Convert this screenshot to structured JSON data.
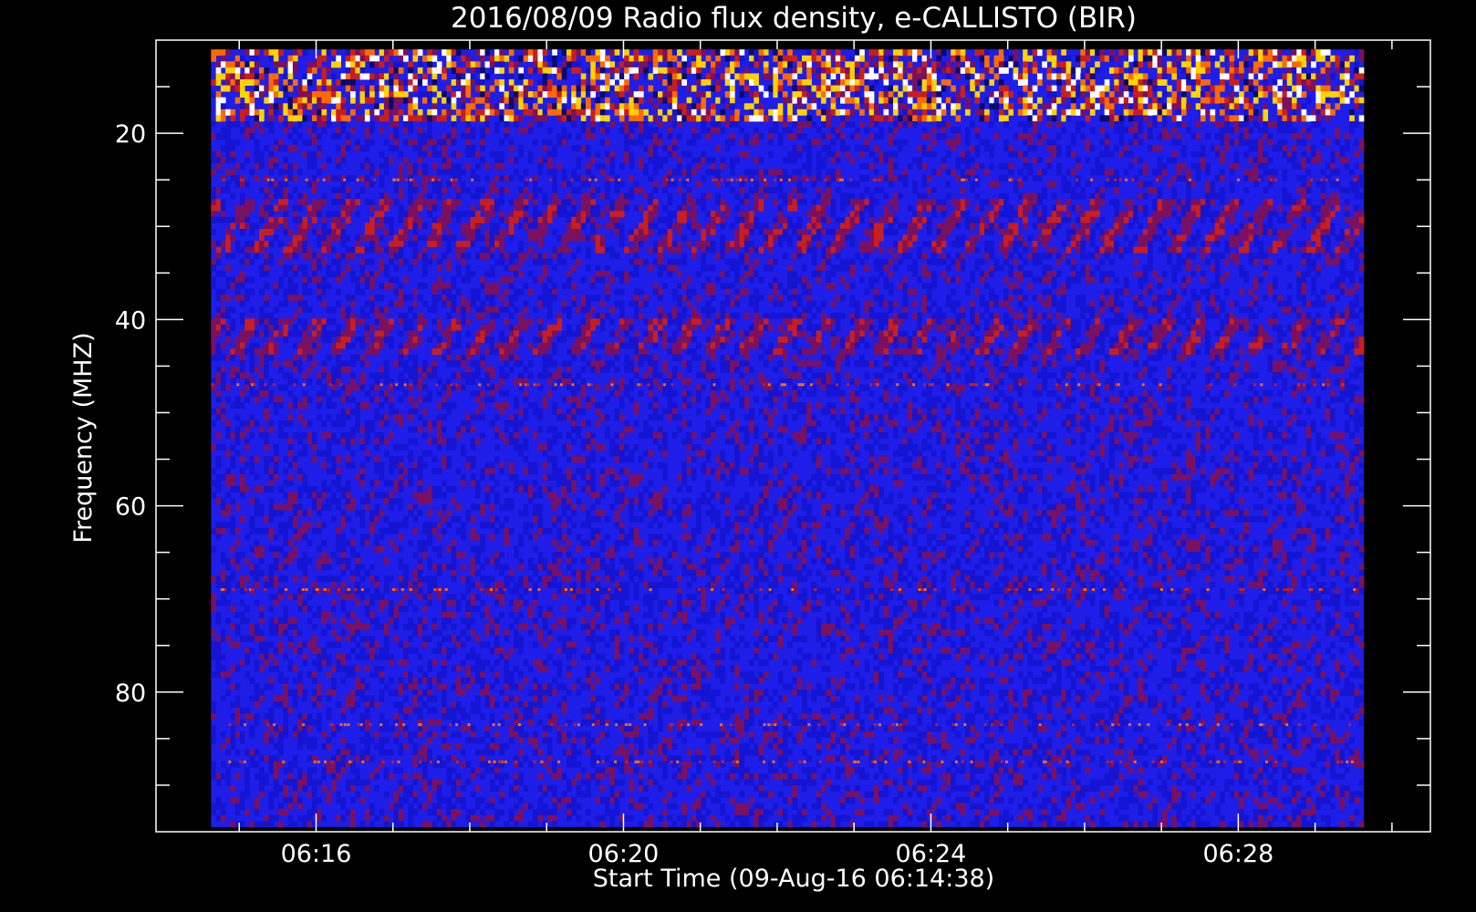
{
  "chart_data": {
    "type": "heatmap",
    "title": "2016/08/09  Radio flux density, e-CALLISTO (BIR)",
    "xlabel": "Start Time (09-Aug-16 06:14:38)",
    "ylabel": "Frequency (MHZ)",
    "x_unit": "time (HH:MM, UT)",
    "xlim": [
      "06:13:55",
      "06:30:30"
    ],
    "ylim": [
      95,
      10
    ],
    "data_range": {
      "time": [
        "06:14:38",
        "06:29:38"
      ],
      "frequency_mhz": [
        11,
        94.5
      ]
    },
    "x_ticks": [
      {
        "time": "06:16",
        "label": "06:16"
      },
      {
        "time": "06:20",
        "label": "06:20"
      },
      {
        "time": "06:24",
        "label": "06:24"
      },
      {
        "time": "06:28",
        "label": "06:28"
      }
    ],
    "x_minor_ticks": [
      "06:15",
      "06:17",
      "06:18",
      "06:19",
      "06:21",
      "06:22",
      "06:23",
      "06:25",
      "06:26",
      "06:27",
      "06:29",
      "06:30"
    ],
    "y_ticks": [
      {
        "value": 20,
        "label": "20"
      },
      {
        "value": 40,
        "label": "40"
      },
      {
        "value": 60,
        "label": "60"
      },
      {
        "value": 80,
        "label": "80"
      }
    ],
    "y_minor_ticks": [
      15,
      25,
      30,
      35,
      45,
      50,
      55,
      65,
      70,
      75,
      85,
      90
    ],
    "colormap": [
      "#000000",
      "#0a0a6e",
      "#1414d2",
      "#2020ff",
      "#7a1060",
      "#c81e1e",
      "#ff6a00",
      "#ffd200",
      "#ffffff"
    ],
    "features": [
      {
        "name": "broadband interference (10–18 MHz)",
        "freq_range_mhz": [
          11,
          18.5
        ],
        "level": "high"
      },
      {
        "name": "narrowband line",
        "freq_mhz": 25,
        "level": "medium"
      },
      {
        "name": "drifting striations",
        "freq_range_mhz": [
          27,
          33
        ],
        "level": "medium"
      },
      {
        "name": "drifting striations",
        "freq_range_mhz": [
          40,
          44
        ],
        "level": "medium"
      },
      {
        "name": "narrowband line",
        "freq_mhz": 47,
        "level": "medium"
      },
      {
        "name": "narrowband line",
        "freq_mhz": 69,
        "level": "medium"
      },
      {
        "name": "narrowband line",
        "freq_mhz": 83.5,
        "level": "medium"
      },
      {
        "name": "narrowband line",
        "freq_mhz": 87.5,
        "level": "medium"
      }
    ]
  }
}
